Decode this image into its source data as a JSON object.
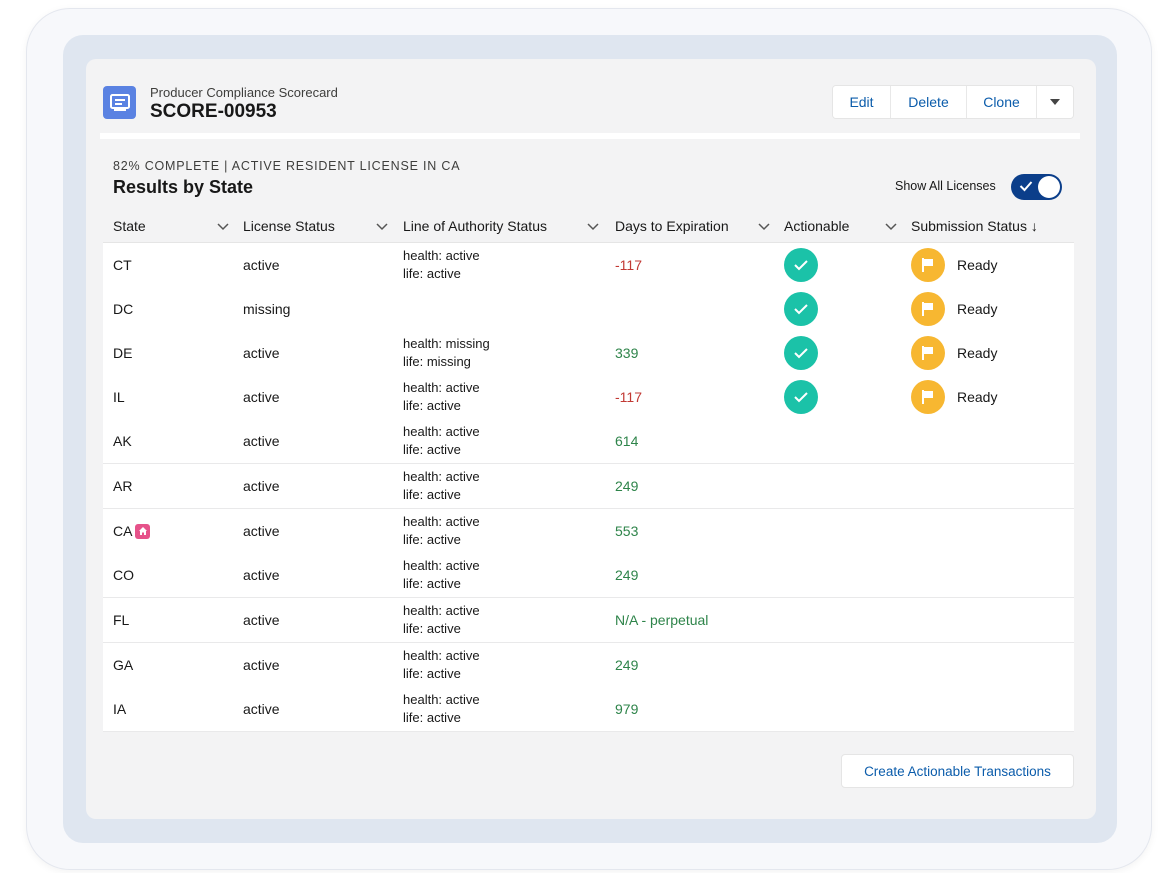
{
  "record": {
    "type_label": "Producer Compliance Scorecard",
    "name": "SCORE-00953"
  },
  "actions": {
    "edit": "Edit",
    "delete": "Delete",
    "clone": "Clone"
  },
  "section": {
    "progress": "82% COMPLETE | ACTIVE RESIDENT LICENSE IN CA",
    "title": "Results by State",
    "toggle_label": "Show All Licenses",
    "toggle_on": true
  },
  "table": {
    "headers": {
      "state": "State",
      "license_status": "License Status",
      "loa_status": "Line of Authority Status",
      "days": "Days to Expiration",
      "actionable": "Actionable",
      "submission": "Submission Status ↓"
    },
    "rows": [
      {
        "state": "CT",
        "license": "active",
        "loa1": "health: active",
        "loa2": "life: active",
        "days": "-117",
        "days_color": "neg",
        "actionable": true,
        "submission": "Ready"
      },
      {
        "state": "DC",
        "license": "missing",
        "loa1": "",
        "loa2": "",
        "days": "",
        "days_color": "",
        "actionable": true,
        "submission": "Ready"
      },
      {
        "state": "DE",
        "license": "active",
        "loa1": "health: missing",
        "loa2": "life: missing",
        "days": "339",
        "days_color": "pos",
        "actionable": true,
        "submission": "Ready"
      },
      {
        "state": "IL",
        "license": "active",
        "loa1": "health: active",
        "loa2": "life: active",
        "days": "-117",
        "days_color": "neg",
        "actionable": true,
        "submission": "Ready"
      },
      {
        "state": "AK",
        "license": "active",
        "loa1": "health: active",
        "loa2": "life: active",
        "days": "614",
        "days_color": "pos",
        "actionable": false,
        "submission": ""
      },
      {
        "state": "AR",
        "license": "active",
        "loa1": "health: active",
        "loa2": "life: active",
        "days": "249",
        "days_color": "pos",
        "actionable": false,
        "submission": ""
      },
      {
        "state": "CA",
        "license": "active",
        "loa1": "health: active",
        "loa2": "life: active",
        "days": "553",
        "days_color": "pos",
        "actionable": false,
        "submission": "",
        "resident": true
      },
      {
        "state": "CO",
        "license": "active",
        "loa1": "health: active",
        "loa2": "life: active",
        "days": "249",
        "days_color": "pos",
        "actionable": false,
        "submission": ""
      },
      {
        "state": "FL",
        "license": "active",
        "loa1": "health: active",
        "loa2": "life: active",
        "days": "N/A - perpetual",
        "days_color": "pos",
        "actionable": false,
        "submission": ""
      },
      {
        "state": "GA",
        "license": "active",
        "loa1": "health: active",
        "loa2": "life: active",
        "days": "249",
        "days_color": "pos",
        "actionable": false,
        "submission": ""
      },
      {
        "state": "IA",
        "license": "active",
        "loa1": "health: active",
        "loa2": "life: active",
        "days": "979",
        "days_color": "pos",
        "actionable": false,
        "submission": ""
      }
    ]
  },
  "footer": {
    "create_button": "Create Actionable Transactions"
  },
  "colors": {
    "link_blue": "#0b5cab",
    "negative_red": "#c23934",
    "positive_green": "#2e844a",
    "actionable_teal": "#1bc2a8",
    "ready_orange": "#f7b731",
    "toggle_navy": "#0b3e8a",
    "record_icon_blue": "#5a82e2",
    "resident_pink": "#e6528a"
  }
}
